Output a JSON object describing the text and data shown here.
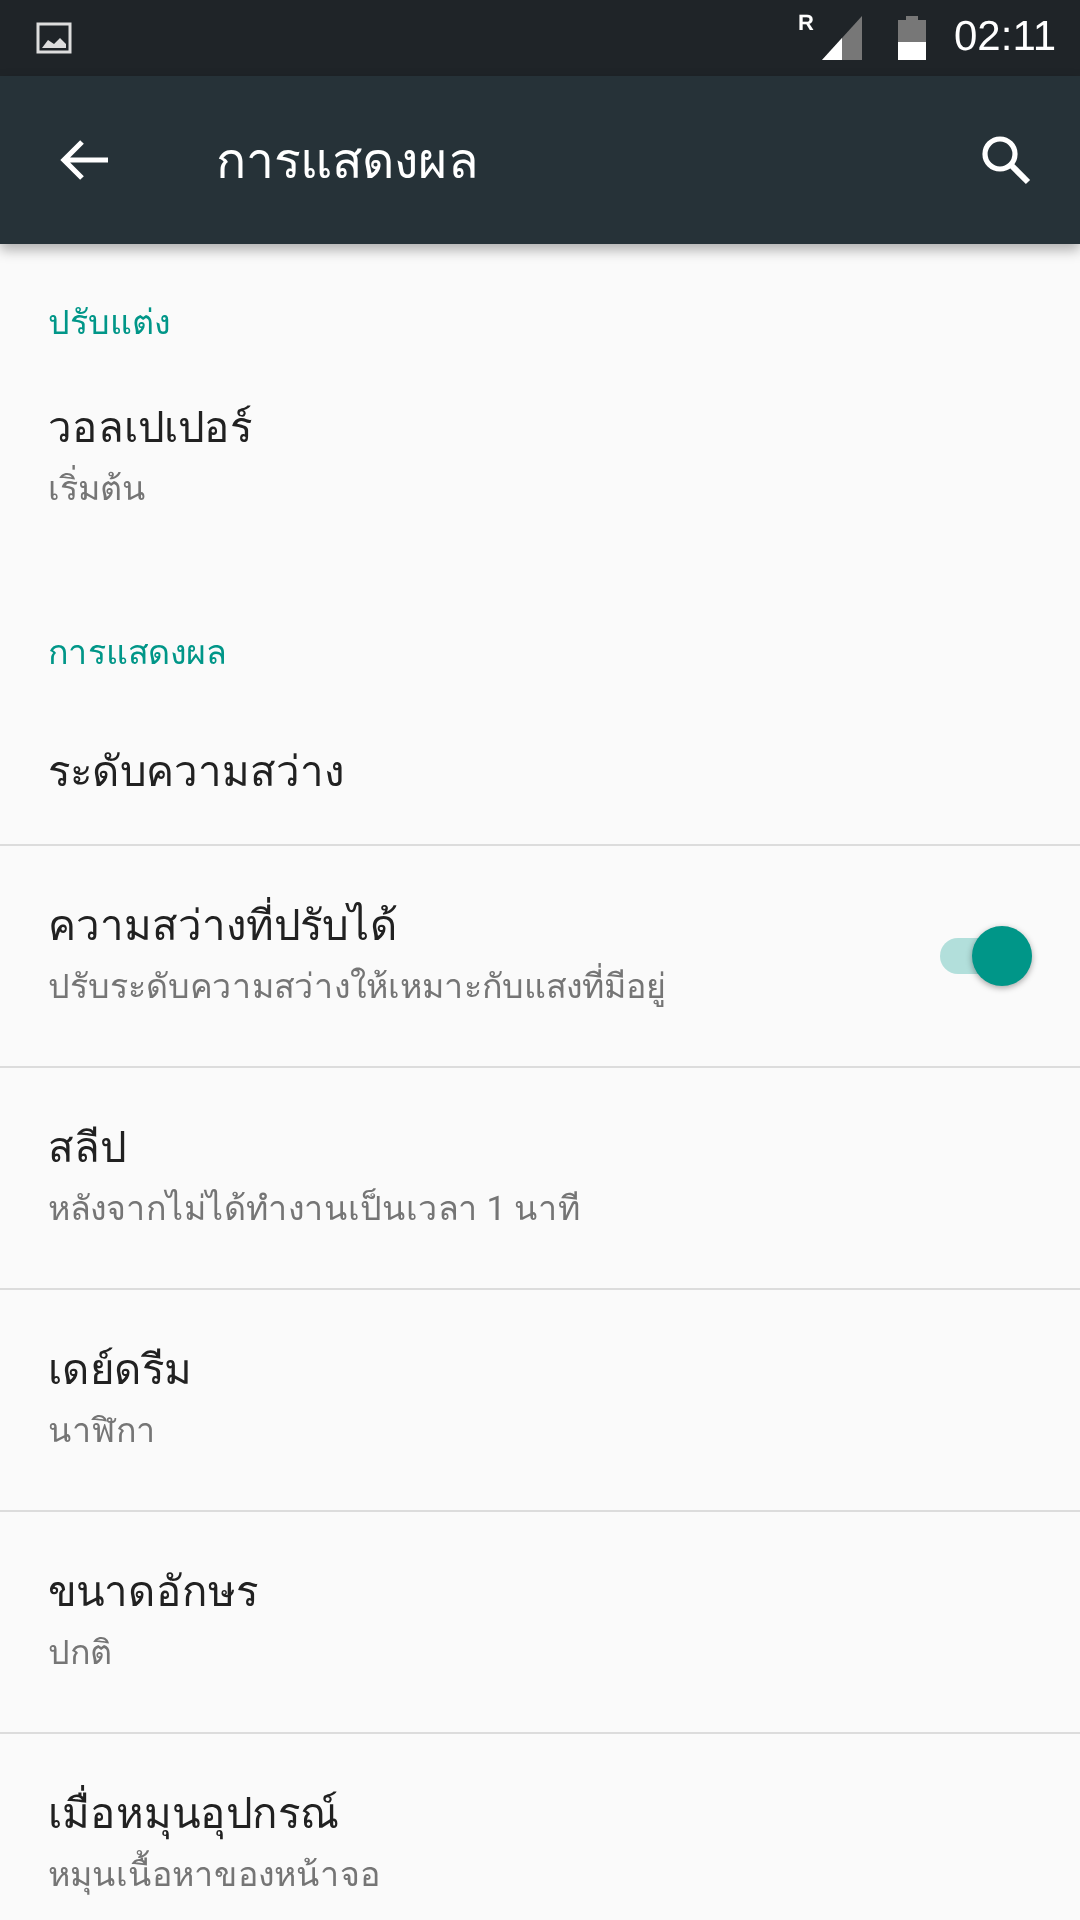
{
  "status_bar": {
    "time": "02:11",
    "roaming": "R"
  },
  "toolbar": {
    "title": "การแสดงผล"
  },
  "sections": [
    {
      "title": "ปรับแต่ง",
      "items": [
        {
          "title": "วอลเปเปอร์",
          "summary": "เริ่มต้น"
        }
      ]
    },
    {
      "title": "การแสดงผล",
      "items": [
        {
          "title": "ระดับความสว่าง"
        },
        {
          "title": "ความสว่างที่ปรับได้",
          "summary": "ปรับระดับความสว่างให้เหมาะกับแสงที่มีอยู่",
          "toggle": {
            "on": true
          }
        },
        {
          "title": "สลีป",
          "summary": "หลังจากไม่ได้ทำงานเป็นเวลา 1 นาที"
        },
        {
          "title": "เดย์ดรีม",
          "summary": "นาฬิกา"
        },
        {
          "title": "ขนาดอักษร",
          "summary": "ปกติ"
        },
        {
          "title": "เมื่อหมุนอุปกรณ์",
          "summary": "หมุนเนื้อหาของหน้าจอ"
        }
      ]
    }
  ]
}
